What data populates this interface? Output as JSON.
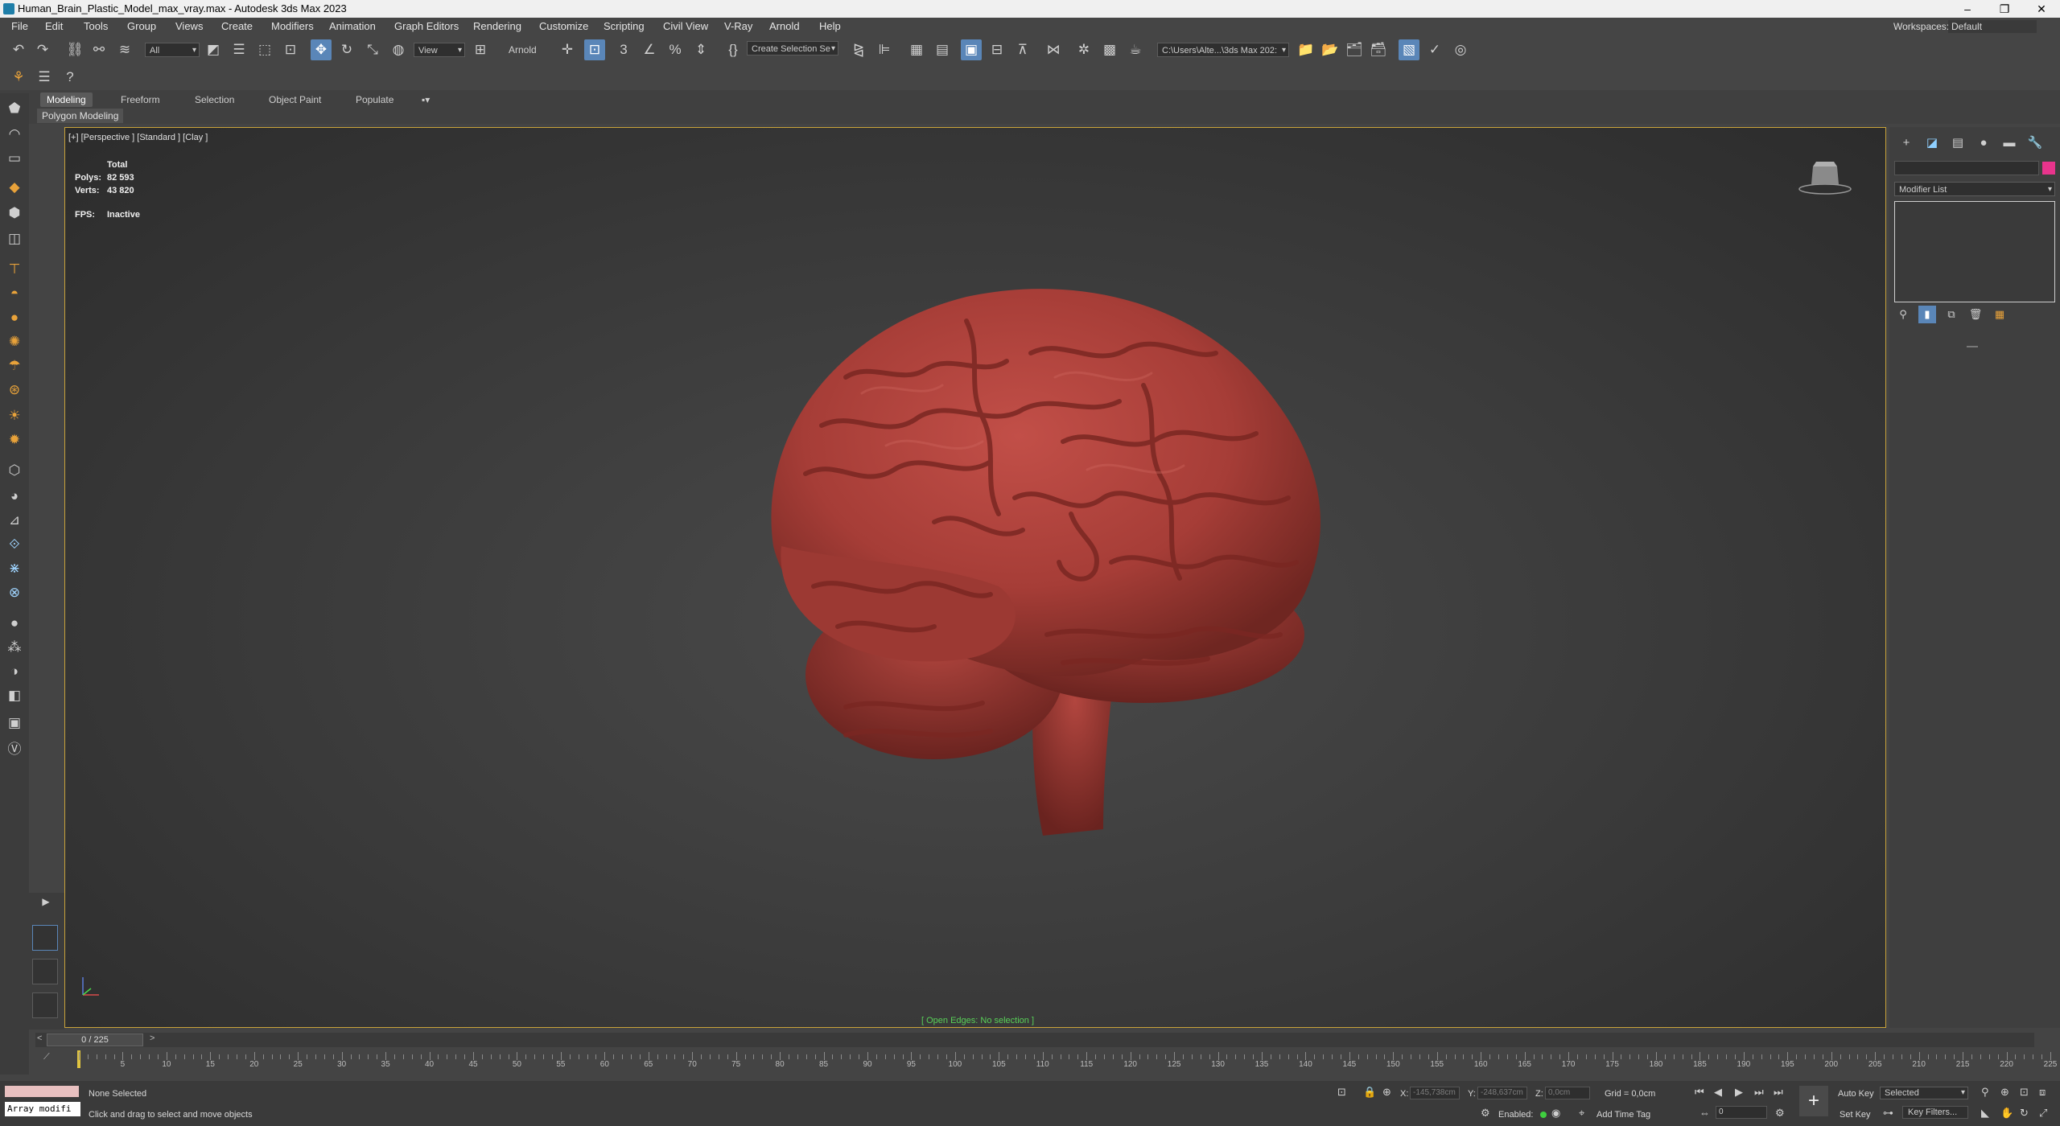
{
  "window": {
    "title": "Human_Brain_Plastic_Model_max_vray.max - Autodesk 3ds Max 2023"
  },
  "menu": [
    "File",
    "Edit",
    "Tools",
    "Group",
    "Views",
    "Create",
    "Modifiers",
    "Animation",
    "Graph Editors",
    "Rendering",
    "Customize",
    "Scripting",
    "Civil View",
    "V-Ray",
    "Arnold",
    "Help"
  ],
  "workspaces": {
    "label": "Workspaces:",
    "value": "Default"
  },
  "toolbar": {
    "selection_filter": "All",
    "reference_coord": "View",
    "arnold_label": "Arnold",
    "create_selection_set": "Create Selection Se",
    "project_path": "C:\\Users\\Alte...\\3ds Max 202:"
  },
  "ribbon": {
    "tabs": [
      "Modeling",
      "Freeform",
      "Selection",
      "Object Paint",
      "Populate"
    ],
    "active_tab": "Modeling",
    "panel": "Polygon Modeling"
  },
  "viewport": {
    "label": "[+] [Perspective ] [Standard ] [Clay ]",
    "stats_total": "Total",
    "polys_label": "Polys:",
    "polys_value": "82 593",
    "verts_label": "Verts:",
    "verts_value": "43 820",
    "fps_label": "FPS:",
    "fps_value": "Inactive",
    "open_edges": "[ Open Edges: No selection ]",
    "object_color": "#b6443f",
    "frame_color": "#c9a33a"
  },
  "command_panel": {
    "modifier_list": "Modifier List",
    "object_color": "#e8348c"
  },
  "timeline": {
    "frame": "0 / 225",
    "end": 225,
    "ticks": [
      5,
      10,
      15,
      20,
      25,
      30,
      35,
      40,
      45,
      50,
      55,
      60,
      65,
      70,
      75,
      80,
      85,
      90,
      95,
      100,
      105,
      110,
      115,
      120,
      125,
      130,
      135,
      140,
      145,
      150,
      155,
      160,
      165,
      170,
      175,
      180,
      185,
      190,
      195,
      200,
      205,
      210,
      215,
      220,
      225
    ]
  },
  "status": {
    "maxscript": "Array modifi",
    "selection": "None Selected",
    "prompt": "Click and drag to select and move objects",
    "x_label": "X:",
    "x_value": "-145,738cm",
    "y_label": "Y:",
    "y_value": "-248,637cm",
    "z_label": "Z:",
    "z_value": "0,0cm",
    "grid": "Grid = 0,0cm",
    "enabled": "Enabled:",
    "add_time_tag": "Add Time Tag",
    "auto_key": "Auto Key",
    "selected": "Selected",
    "set_key": "Set Key",
    "key_filters": "Key Filters...",
    "current_frame": "0"
  }
}
